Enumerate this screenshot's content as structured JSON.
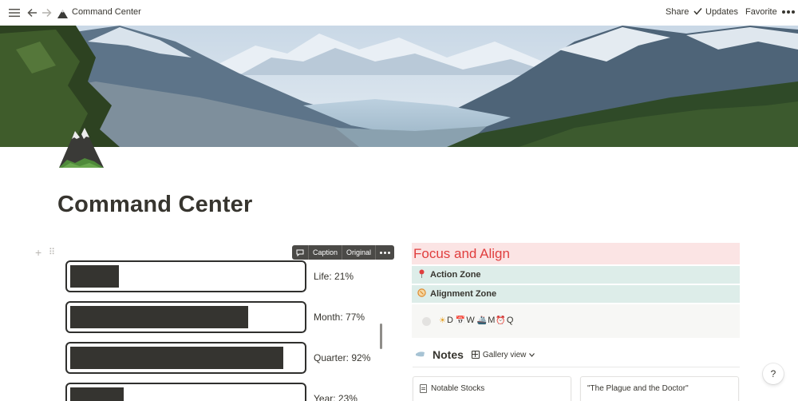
{
  "topbar": {
    "page_title": "Command Center",
    "share_label": "Share",
    "updates_label": "Updates",
    "favorite_label": "Favorite"
  },
  "page": {
    "title": "Command Center"
  },
  "image_toolbar": {
    "caption_label": "Caption",
    "original_label": "Original"
  },
  "progress": [
    {
      "label": "Life: 21%",
      "fraction": 0.21
    },
    {
      "label": "Month: 77%",
      "fraction": 0.77
    },
    {
      "label": "Quarter: 92%",
      "fraction": 0.92
    },
    {
      "label": "Year: 23%",
      "fraction": 0.23
    }
  ],
  "focus": {
    "heading": "Focus and Align",
    "heading_color": "#e03e3e",
    "heading_bg": "#fbe4e4",
    "zones": [
      {
        "label": "Action Zone",
        "icon": "pin-icon"
      },
      {
        "label": "Alignment Zone",
        "icon": "compass-icon"
      }
    ],
    "callout": {
      "items": [
        {
          "emoji": "☀",
          "text": "D"
        },
        {
          "emoji": "📅",
          "text": "W"
        },
        {
          "emoji": "🚢",
          "text": "M"
        },
        {
          "emoji": "⏰",
          "text": "Q"
        }
      ]
    },
    "zone_bg": "#ddede9"
  },
  "notes": {
    "title": "Notes",
    "view_label": "Gallery view",
    "cards": [
      {
        "title": "Notable Stocks",
        "has_icon": true
      },
      {
        "title": "\"The Plague and the Doctor\"",
        "has_icon": false
      }
    ]
  },
  "help_label": "?"
}
